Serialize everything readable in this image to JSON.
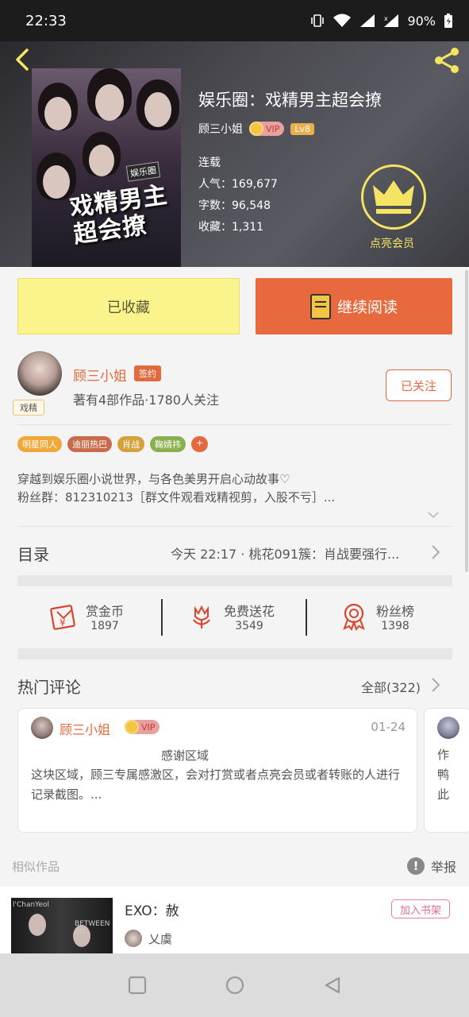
{
  "status_bar": {
    "time": "22:33",
    "battery": "90%"
  },
  "book": {
    "title": "娱乐圈：戏精男主超会撩",
    "author": "顾三小姐",
    "vip_label": "VIP",
    "level": "Lv8",
    "status": "连载",
    "popularity": "人气：169,677",
    "word_count": "字数：96,548",
    "favorites": "收藏：1,311",
    "vip_member_label": "点亮会员",
    "cover_title": "戏精男主超会撩",
    "cover_badge": "娱乐圈"
  },
  "actions": {
    "collected_label": "已收藏",
    "read_label": "继续阅读"
  },
  "author_block": {
    "name": "顾三小姐",
    "signed_label": "签约",
    "tag_label": "戏精",
    "stats": "著有4部作品·1780人关注",
    "follow_label": "已关注"
  },
  "tags": [
    {
      "label": "明星同人",
      "color": "#f0a83a"
    },
    {
      "label": "迪丽热巴",
      "color": "#c96a4a"
    },
    {
      "label": "肖战",
      "color": "#d7a13a"
    },
    {
      "label": "鞠婧祎",
      "color": "#8ab04e"
    },
    {
      "label": "+",
      "color": "#e36a3e"
    }
  ],
  "description": {
    "line1": "穿越到娱乐圈小说世界，与各色美男开启心动故事♡",
    "line2": "粉丝群：812310213［群文件观看戏精视剪，入股不亏］..."
  },
  "toc": {
    "label": "目录",
    "latest": "今天 22:17 · 桃花091簇：肖战要强行..."
  },
  "stats": [
    {
      "label": "赏金币",
      "value": "1897",
      "icon": "red-envelope-icon"
    },
    {
      "label": "免费送花",
      "value": "3549",
      "icon": "flower-icon"
    },
    {
      "label": "粉丝榜",
      "value": "1398",
      "icon": "medal-icon"
    }
  ],
  "hot_comments": {
    "label": "热门评论",
    "all_label": "全部(322)",
    "items": [
      {
        "name": "顾三小姐",
        "vip_label": "VIP",
        "date": "01-24",
        "title": "感谢区域",
        "body": "这块区域，顾三专属感激区，会对打赏或者点亮会员或者转账的人进行记录截图。..."
      },
      {
        "body": "作鸭此"
      }
    ]
  },
  "similar": {
    "label": "相似作品",
    "report_label": "举报",
    "items": [
      {
        "title": "EXO：赦",
        "author": "乂虞",
        "add_label": "加入书架",
        "cover_text_1": "l'ChanYeol",
        "cover_text_2": "BETWEEN AN"
      }
    ]
  },
  "colors": {
    "accent": "#e36a3e",
    "collected_bg": "#fbf38b",
    "read_bg": "#e8693e",
    "vip_gold": "#f5e463"
  }
}
